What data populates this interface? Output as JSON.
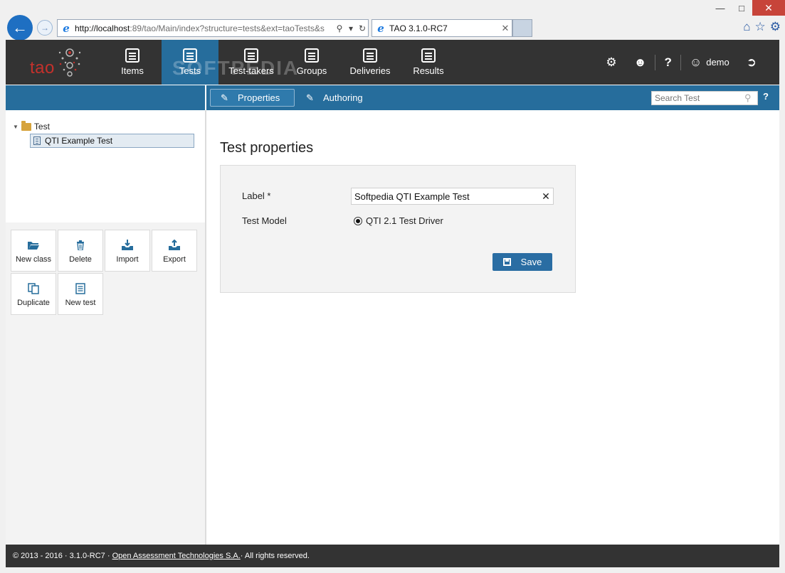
{
  "browser": {
    "url_host": "http://localhost",
    "url_rest": ":89/tao/Main/index?structure=tests&ext=taoTests&s",
    "tab_title": "TAO 3.1.0-RC7",
    "window_controls": [
      "minimize",
      "maximize",
      "close"
    ],
    "icons": [
      "home-icon",
      "favorites-star-icon",
      "settings-gear-icon"
    ]
  },
  "topnav": {
    "logo_text": "tao",
    "items": [
      {
        "label": "Items",
        "icon": "items-icon"
      },
      {
        "label": "Tests",
        "icon": "tests-icon",
        "active": true
      },
      {
        "label": "Test-takers",
        "icon": "test-takers-icon"
      },
      {
        "label": "Groups",
        "icon": "groups-icon"
      },
      {
        "label": "Deliveries",
        "icon": "deliveries-icon"
      },
      {
        "label": "Results",
        "icon": "results-icon"
      }
    ],
    "user": "demo",
    "right_icons": [
      "settings-icon",
      "users-icon",
      "help-icon",
      "user-icon",
      "logout-icon"
    ],
    "help_label": "?"
  },
  "watermark": "SOFTPEDIA",
  "subnav": {
    "tabs": [
      {
        "label": "Properties",
        "active": true
      },
      {
        "label": "Authoring",
        "active": false
      }
    ],
    "search_placeholder": "Search Test",
    "help_label": "?"
  },
  "tree": {
    "root_label": "Test",
    "items": [
      {
        "label": "QTI Example Test",
        "selected": true
      }
    ]
  },
  "actions": [
    {
      "label": "New class",
      "icon": "folder-open-icon"
    },
    {
      "label": "Delete",
      "icon": "trash-icon"
    },
    {
      "label": "Import",
      "icon": "import-icon"
    },
    {
      "label": "Export",
      "icon": "export-icon"
    },
    {
      "label": "Duplicate",
      "icon": "duplicate-icon"
    },
    {
      "label": "New test",
      "icon": "new-test-icon"
    }
  ],
  "main": {
    "title": "Test properties",
    "form": {
      "label_field_label": "Label *",
      "label_value": "Softpedia QTI Example Test",
      "model_label": "Test Model",
      "model_option": "QTI 2.1 Test Driver",
      "save_label": "Save"
    }
  },
  "footer": {
    "prefix": "© 2013 - 2016 · 3.1.0-RC7 · ",
    "link": "Open Assessment Technologies S.A.",
    "suffix": " · All rights reserved."
  },
  "colors": {
    "nav_bg": "#333333",
    "accent_blue": "#266d9c",
    "logo_red": "#c4312c",
    "save_button": "#2a6da3"
  }
}
